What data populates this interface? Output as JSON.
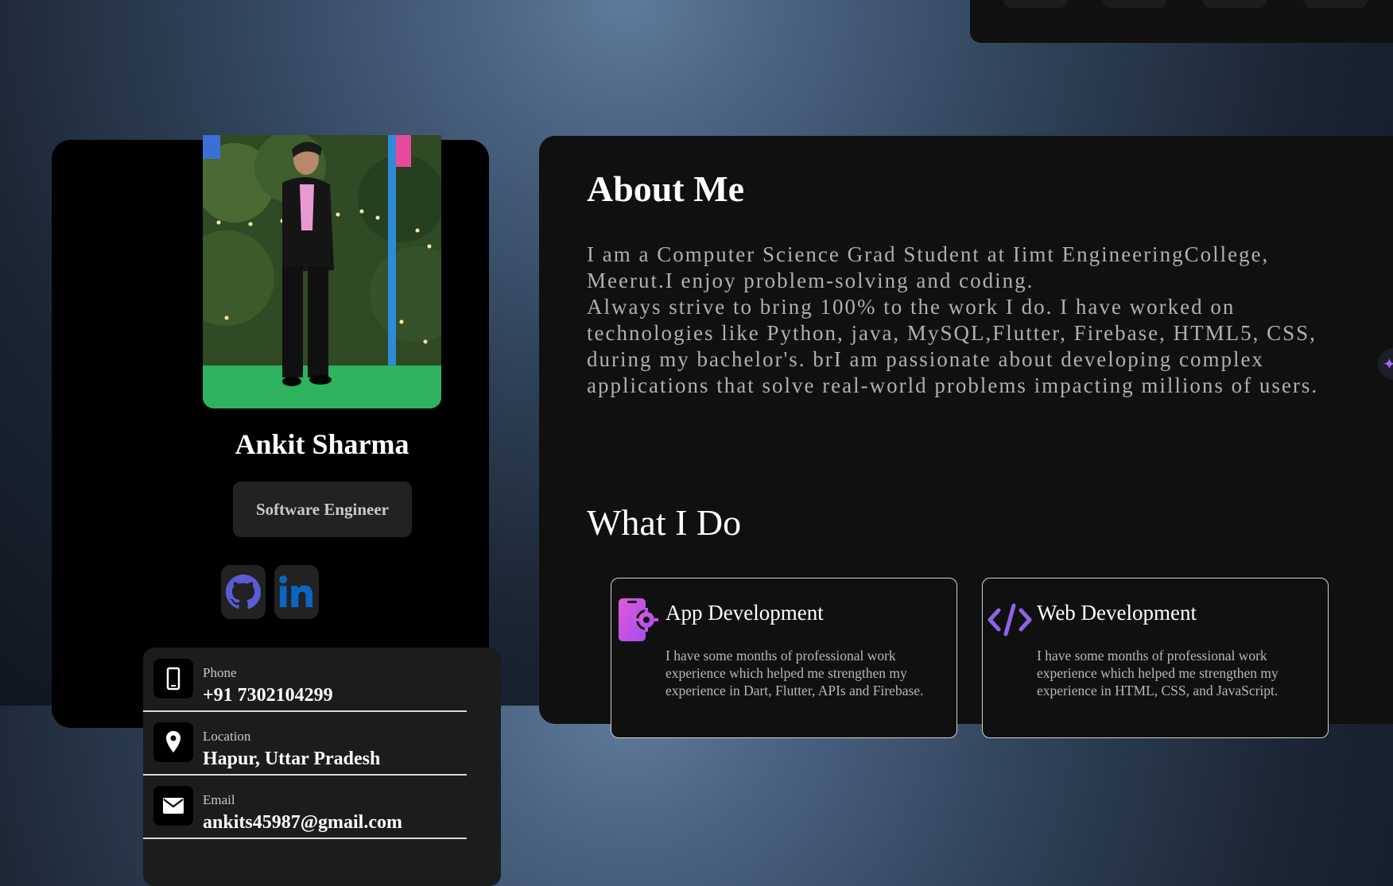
{
  "profile": {
    "name": "Ankit Sharma",
    "role": "Software Engineer",
    "photo_alt": "profile-photo",
    "socials": [
      {
        "name": "github",
        "icon": "github-icon",
        "color": "#5b5bd6"
      },
      {
        "name": "linkedin",
        "icon": "linkedin-icon",
        "color": "#0a66c2"
      }
    ],
    "contacts": [
      {
        "label": "Phone",
        "value": "+91 7302104299",
        "icon": "phone-icon"
      },
      {
        "label": "Location",
        "value": "Hapur, Uttar Pradesh",
        "icon": "location-pin-icon"
      },
      {
        "label": "Email",
        "value": "ankits45987@gmail.com",
        "icon": "mail-icon"
      }
    ]
  },
  "about": {
    "title": "About Me",
    "line1": "I am a Computer Science Grad Student at Iimt EngineeringCollege, Meerut.I enjoy problem-solving and coding.",
    "line2": "Always strive to bring 100% to the work I do. I have worked on technologies like Python, java, MySQL,Flutter, Firebase, HTML5, CSS, during my bachelor's. brI am passionate about developing complex applications that solve real-world problems impacting millions of users."
  },
  "what_i_do": {
    "title": "What I Do",
    "services": [
      {
        "title": "App Development",
        "icon": "mobile-gear-icon",
        "description": "I have some months of professional work experience which helped me strengthen my experience in Dart, Flutter, APIs and Firebase."
      },
      {
        "title": "Web Development",
        "icon": "code-brackets-icon",
        "description": "I have some months of professional work experience which helped me strengthen my experience in HTML, CSS, and JavaScript."
      }
    ]
  },
  "colors": {
    "accent_purple": "#9b6dff",
    "accent_pink": "#d36cf0",
    "card_bg": "#101010",
    "profile_bg": "#000000"
  }
}
